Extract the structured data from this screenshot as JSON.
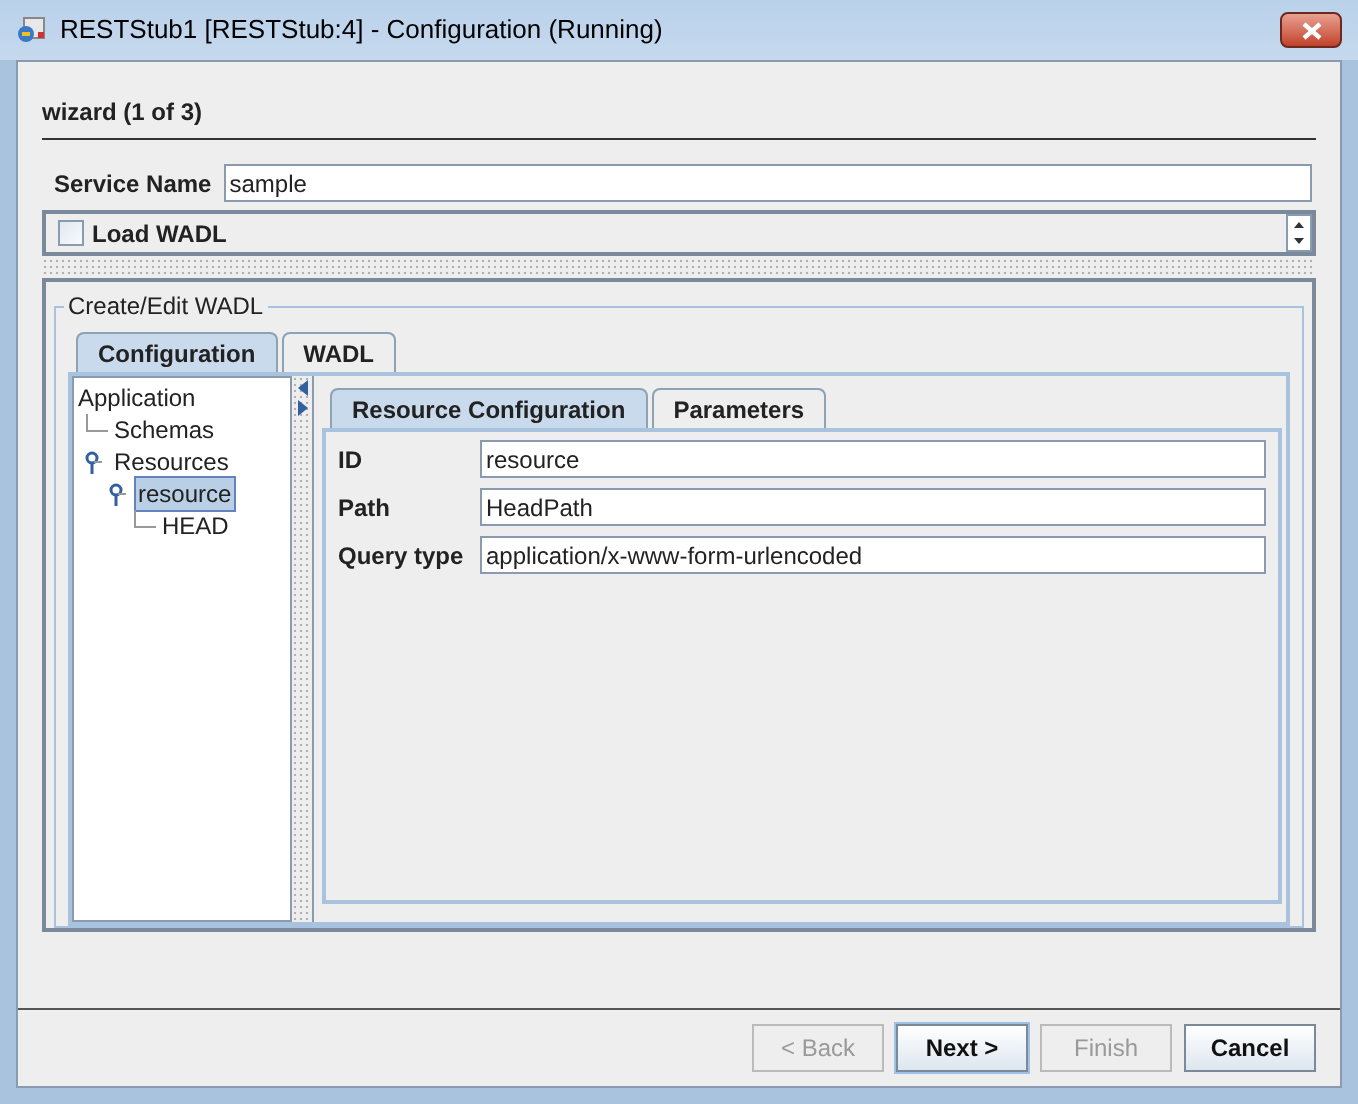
{
  "window": {
    "title": "RESTStub1 [RESTStub:4] - Configuration (Running)"
  },
  "wizard_step": "wizard (1 of 3)",
  "service_name": {
    "label": "Service Name",
    "value": "sample"
  },
  "load_wadl": {
    "label": "Load WADL",
    "checked": false
  },
  "group": {
    "title": "Create/Edit WADL"
  },
  "tabs": [
    {
      "label": "Configuration",
      "selected": true
    },
    {
      "label": "WADL",
      "selected": false
    }
  ],
  "tree": [
    {
      "label": "Application",
      "selected": false,
      "expanded": true,
      "children": [
        {
          "label": "Schemas",
          "selected": false
        },
        {
          "label": "Resources",
          "selected": false,
          "expanded": true,
          "children": [
            {
              "label": "resource",
              "selected": true,
              "expanded": true,
              "children": [
                {
                  "label": "HEAD",
                  "selected": false
                }
              ]
            }
          ]
        }
      ]
    }
  ],
  "detail_tabs": [
    {
      "label": "Resource Configuration",
      "selected": true
    },
    {
      "label": "Parameters",
      "selected": false
    }
  ],
  "fields": [
    {
      "label": "ID",
      "value": "resource"
    },
    {
      "label": "Path",
      "value": "HeadPath"
    },
    {
      "label": "Query type",
      "value": "application/x-www-form-urlencoded"
    }
  ],
  "buttons": [
    {
      "label": "< Back",
      "disabled": true,
      "default": false
    },
    {
      "label": "Next >",
      "disabled": false,
      "default": true
    },
    {
      "label": "Finish",
      "disabled": true,
      "default": false
    },
    {
      "label": "Cancel",
      "disabled": false,
      "default": false
    }
  ]
}
